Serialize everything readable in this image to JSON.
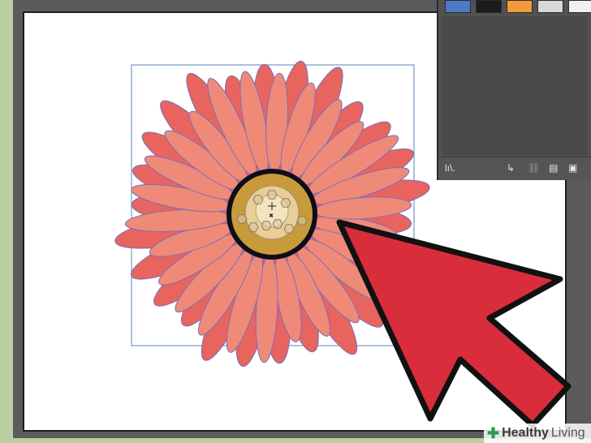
{
  "colors": {
    "background": "#5b5b5b",
    "petal_dark": "#e8645e",
    "petal_light": "#f08a78",
    "petal_outline": "#7a6fb8",
    "center_ring": "#0d0d1a",
    "center_fill": "#c79a3c",
    "center_light": "#f0dcae",
    "arrow_fill": "#d92d3c",
    "arrow_outline": "#111111",
    "selection_box": "#5a7fc2"
  },
  "panel": {
    "swatches": [
      {
        "name": "blue-swatch",
        "color": "#4e79c6"
      },
      {
        "name": "black-splatter-swatch",
        "color": "#1c1c1c"
      },
      {
        "name": "orange-swatch",
        "color": "#f39a3a"
      },
      {
        "name": "gray-swatch",
        "color": "#d8d8d8"
      },
      {
        "name": "white-swatch",
        "color": "#f0f0f0"
      }
    ],
    "footer_icons": {
      "libraries": "lı\\.",
      "place": "↳",
      "break_link": "⛓",
      "options": "▤",
      "new": "▣",
      "delete": "🗑"
    }
  },
  "watermark": {
    "symbol": "✚",
    "brand_bold": "Healthy",
    "brand_light": "Living"
  }
}
